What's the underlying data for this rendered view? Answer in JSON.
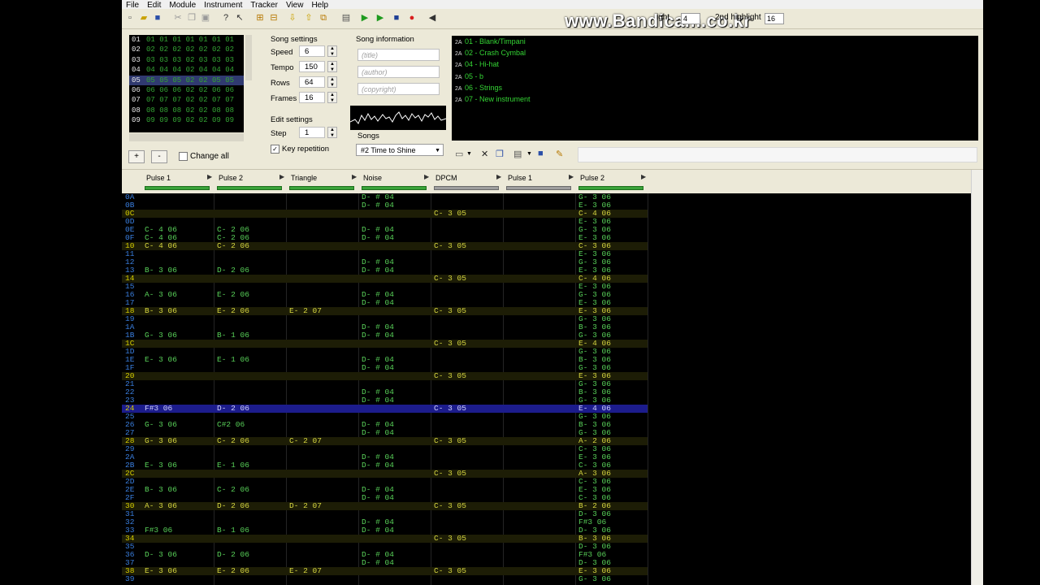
{
  "menu": [
    "File",
    "Edit",
    "Module",
    "Instrument",
    "Tracker",
    "View",
    "Help"
  ],
  "watermark": "www.Bandicam.co.kr",
  "highlight": {
    "label1": "ight",
    "value1": "4",
    "label2": "2nd highlight",
    "value2": "16"
  },
  "frames": {
    "rows": [
      {
        "num": "01",
        "cells": "01 01 01 01 01 01 01"
      },
      {
        "num": "02",
        "cells": "02 02 02 02 02 02 02"
      },
      {
        "num": "03",
        "cells": "03 03 03 02 03 03 03"
      },
      {
        "num": "04",
        "cells": "04 04 04 02 04 04 04"
      },
      {
        "num": "05",
        "cells": "05 05 05 02 02 05 05"
      },
      {
        "num": "06",
        "cells": "06 06 06 02 02 06 06"
      },
      {
        "num": "07",
        "cells": "07 07 07 02 02 07 07"
      },
      {
        "num": "08",
        "cells": "08 08 08 02 02 08 08"
      },
      {
        "num": "09",
        "cells": "09 09 09 02 02 09 09"
      }
    ],
    "add": "+",
    "remove": "-",
    "change_all": "Change all"
  },
  "song_settings": {
    "title": "Song settings",
    "speed_label": "Speed",
    "speed": "6",
    "tempo_label": "Tempo",
    "tempo": "150",
    "rows_label": "Rows",
    "rows": "64",
    "frames_label": "Frames",
    "frames": "16"
  },
  "edit_settings": {
    "title": "Edit settings",
    "step_label": "Step",
    "step": "1",
    "key_repetition": "Key repetition"
  },
  "song_info": {
    "title": "Song information",
    "title_ph": "(title)",
    "author_ph": "(author)",
    "copyright_ph": "(copyright)"
  },
  "songs": {
    "label": "Songs",
    "selected": "#2 Time to Shine"
  },
  "instruments": [
    "01 - Blank/Timpani",
    "02 - Crash Cymbal",
    "04 - Hi-hat",
    "05 - b",
    "06 - Strings",
    "07 - New instrument"
  ],
  "channels": [
    "Pulse 1",
    "Pulse 2",
    "Triangle",
    "Noise",
    "DPCM",
    "Pulse 1",
    "Pulse 2"
  ],
  "pattern_rows": [
    {
      "n": "0A",
      "c": [
        "",
        "",
        "",
        "D- # 04",
        "",
        "",
        "G- 3 06"
      ]
    },
    {
      "n": "0B",
      "c": [
        "",
        "",
        "",
        "D- # 04",
        "",
        "",
        "E- 3 06"
      ]
    },
    {
      "n": "0C",
      "c": [
        "",
        "",
        "",
        "",
        "C- 3 05",
        "",
        "C- 4 06"
      ]
    },
    {
      "n": "0D",
      "c": [
        "",
        "",
        "",
        "",
        "",
        "",
        "E- 3 06"
      ]
    },
    {
      "n": "0E",
      "c": [
        "C- 4 06",
        "C- 2 06",
        "",
        "D- # 04",
        "",
        "",
        "G- 3 06"
      ]
    },
    {
      "n": "0F",
      "c": [
        "C- 4 06",
        "C- 2 06",
        "",
        "D- # 04",
        "",
        "",
        "E- 3 06"
      ]
    },
    {
      "n": "10",
      "c": [
        "C- 4 06",
        "C- 2 06",
        "",
        "",
        "C- 3 05",
        "",
        "C- 3 06"
      ]
    },
    {
      "n": "11",
      "c": [
        "",
        "",
        "",
        "",
        "",
        "",
        "E- 3 06"
      ]
    },
    {
      "n": "12",
      "c": [
        "",
        "",
        "",
        "D- # 04",
        "",
        "",
        "G- 3 06"
      ]
    },
    {
      "n": "13",
      "c": [
        "B- 3 06",
        "D- 2 06",
        "",
        "D- # 04",
        "",
        "",
        "E- 3 06"
      ]
    },
    {
      "n": "14",
      "c": [
        "",
        "",
        "",
        "",
        "C- 3 05",
        "",
        "C- 4 06"
      ]
    },
    {
      "n": "15",
      "c": [
        "",
        "",
        "",
        "",
        "",
        "",
        "E- 3 06"
      ]
    },
    {
      "n": "16",
      "c": [
        "A- 3 06",
        "E- 2 06",
        "",
        "D- # 04",
        "",
        "",
        "G- 3 06"
      ]
    },
    {
      "n": "17",
      "c": [
        "",
        "",
        "",
        "D- # 04",
        "",
        "",
        "E- 3 06"
      ]
    },
    {
      "n": "18",
      "c": [
        "B- 3 06",
        "E- 2 06",
        "E- 2 07",
        "",
        "C- 3 05",
        "",
        "E- 3 06"
      ]
    },
    {
      "n": "19",
      "c": [
        "",
        "",
        "",
        "",
        "",
        "",
        "G- 3 06"
      ]
    },
    {
      "n": "1A",
      "c": [
        "",
        "",
        "",
        "D- # 04",
        "",
        "",
        "B- 3 06"
      ]
    },
    {
      "n": "1B",
      "c": [
        "G- 3 06",
        "B- 1 06",
        "",
        "D- # 04",
        "",
        "",
        "G- 3 06"
      ]
    },
    {
      "n": "1C",
      "c": [
        "",
        "",
        "",
        "",
        "C- 3 05",
        "",
        "E- 4 06"
      ]
    },
    {
      "n": "1D",
      "c": [
        "",
        "",
        "",
        "",
        "",
        "",
        "G- 3 06"
      ]
    },
    {
      "n": "1E",
      "c": [
        "E- 3 06",
        "E- 1 06",
        "",
        "D- # 04",
        "",
        "",
        "B- 3 06"
      ]
    },
    {
      "n": "1F",
      "c": [
        "",
        "",
        "",
        "D- # 04",
        "",
        "",
        "G- 3 06"
      ]
    },
    {
      "n": "20",
      "c": [
        "",
        "",
        "",
        "",
        "C- 3 05",
        "",
        "E- 3 06"
      ]
    },
    {
      "n": "21",
      "c": [
        "",
        "",
        "",
        "",
        "",
        "",
        "G- 3 06"
      ]
    },
    {
      "n": "22",
      "c": [
        "",
        "",
        "",
        "D- # 04",
        "",
        "",
        "B- 3 06"
      ]
    },
    {
      "n": "23",
      "c": [
        "",
        "",
        "",
        "D- # 04",
        "",
        "",
        "G- 3 06"
      ]
    },
    {
      "n": "24",
      "c": [
        "F#3 06",
        "D- 2 06",
        "",
        "",
        "C- 3 05",
        "",
        "E- 4 06"
      ]
    },
    {
      "n": "25",
      "c": [
        "",
        "",
        "",
        "",
        "",
        "",
        "G- 3 06"
      ]
    },
    {
      "n": "26",
      "c": [
        "G- 3 06",
        "C#2 06",
        "",
        "D- # 04",
        "",
        "",
        "B- 3 06"
      ]
    },
    {
      "n": "27",
      "c": [
        "",
        "",
        "",
        "D- # 04",
        "",
        "",
        "G- 3 06"
      ]
    },
    {
      "n": "28",
      "c": [
        "G- 3 06",
        "C- 2 06",
        "C- 2 07",
        "",
        "C- 3 05",
        "",
        "A- 2 06"
      ]
    },
    {
      "n": "29",
      "c": [
        "",
        "",
        "",
        "",
        "",
        "",
        "C- 3 06"
      ]
    },
    {
      "n": "2A",
      "c": [
        "",
        "",
        "",
        "D- # 04",
        "",
        "",
        "E- 3 06"
      ]
    },
    {
      "n": "2B",
      "c": [
        "E- 3 06",
        "E- 1 06",
        "",
        "D- # 04",
        "",
        "",
        "C- 3 06"
      ]
    },
    {
      "n": "2C",
      "c": [
        "",
        "",
        "",
        "",
        "C- 3 05",
        "",
        "A- 3 06"
      ]
    },
    {
      "n": "2D",
      "c": [
        "",
        "",
        "",
        "",
        "",
        "",
        "C- 3 06"
      ]
    },
    {
      "n": "2E",
      "c": [
        "B- 3 06",
        "C- 2 06",
        "",
        "D- # 04",
        "",
        "",
        "E- 3 06"
      ]
    },
    {
      "n": "2F",
      "c": [
        "",
        "",
        "",
        "D- # 04",
        "",
        "",
        "C- 3 06"
      ]
    },
    {
      "n": "30",
      "c": [
        "A- 3 06",
        "D- 2 06",
        "D- 2 07",
        "",
        "C- 3 05",
        "",
        "B- 2 06"
      ]
    },
    {
      "n": "31",
      "c": [
        "",
        "",
        "",
        "",
        "",
        "",
        "D- 3 06"
      ]
    },
    {
      "n": "32",
      "c": [
        "",
        "",
        "",
        "D- # 04",
        "",
        "",
        "F#3 06"
      ]
    },
    {
      "n": "33",
      "c": [
        "F#3 06",
        "B- 1 06",
        "",
        "D- # 04",
        "",
        "",
        "D- 3 06"
      ]
    },
    {
      "n": "34",
      "c": [
        "",
        "",
        "",
        "",
        "C- 3 05",
        "",
        "B- 3 06"
      ]
    },
    {
      "n": "35",
      "c": [
        "",
        "",
        "",
        "",
        "",
        "",
        "D- 3 06"
      ]
    },
    {
      "n": "36",
      "c": [
        "D- 3 06",
        "D- 2 06",
        "",
        "D- # 04",
        "",
        "",
        "F#3 06"
      ]
    },
    {
      "n": "37",
      "c": [
        "",
        "",
        "",
        "D- # 04",
        "",
        "",
        "D- 3 06"
      ]
    },
    {
      "n": "38",
      "c": [
        "E- 3 06",
        "E- 2 06",
        "E- 2 07",
        "",
        "C- 3 05",
        "",
        "E- 3 06"
      ]
    },
    {
      "n": "39",
      "c": [
        "",
        "",
        "",
        "",
        "",
        "",
        "G- 3 06"
      ]
    }
  ]
}
